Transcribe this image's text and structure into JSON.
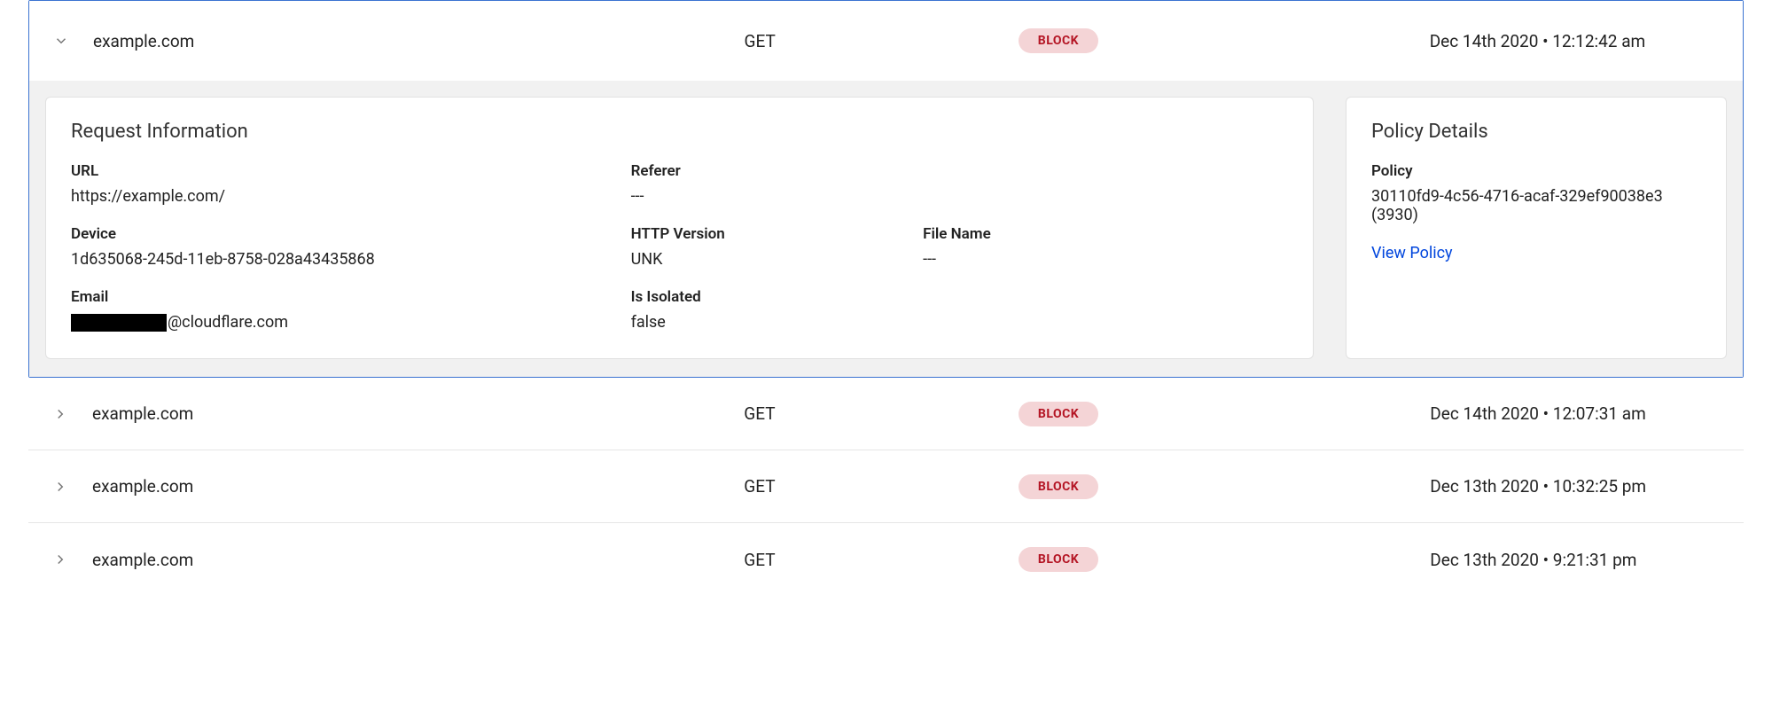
{
  "rows": [
    {
      "domain": "example.com",
      "method": "GET",
      "status": "BLOCK",
      "time": "Dec 14th 2020 • 12:12:42 am",
      "expanded": true,
      "details": {
        "request_info": {
          "title": "Request Information",
          "url_label": "URL",
          "url_value": "https://example.com/",
          "referer_label": "Referer",
          "referer_value": "---",
          "device_label": "Device",
          "device_value": "1d635068-245d-11eb-8758-028a43435868",
          "http_version_label": "HTTP Version",
          "http_version_value": "UNK",
          "file_name_label": "File Name",
          "file_name_value": "---",
          "email_label": "Email",
          "email_domain": "@cloudflare.com",
          "is_isolated_label": "Is Isolated",
          "is_isolated_value": "false"
        },
        "policy_details": {
          "title": "Policy Details",
          "policy_label": "Policy",
          "policy_value": "30110fd9-4c56-4716-acaf-329ef90038e3 (3930)",
          "view_policy_text": "View Policy"
        }
      }
    },
    {
      "domain": "example.com",
      "method": "GET",
      "status": "BLOCK",
      "time": "Dec 14th 2020 • 12:07:31 am"
    },
    {
      "domain": "example.com",
      "method": "GET",
      "status": "BLOCK",
      "time": "Dec 13th 2020 • 10:32:25 pm"
    },
    {
      "domain": "example.com",
      "method": "GET",
      "status": "BLOCK",
      "time": "Dec 13th 2020 • 9:21:31 pm"
    }
  ]
}
